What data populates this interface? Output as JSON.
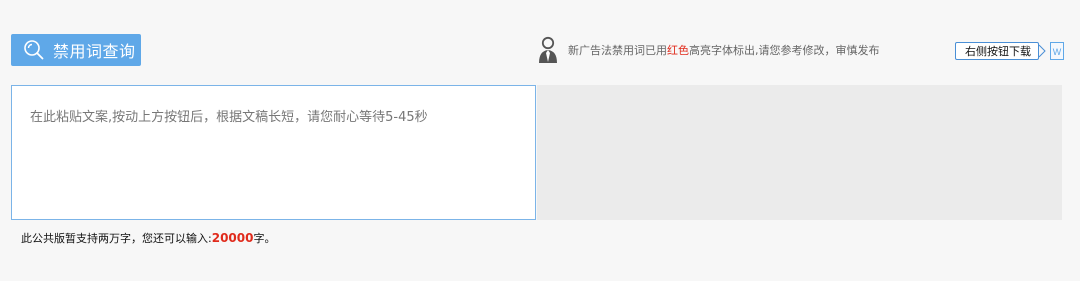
{
  "toolbar": {
    "query_button_label": "禁用词查询",
    "query_icon": "search-icon"
  },
  "notice": {
    "icon": "person-icon",
    "text_before": "新广告法禁用词已用",
    "highlight": "红色",
    "text_after": "高亮字体标出,请您参考修改，审慎发布",
    "highlight_color": "#e02b1c"
  },
  "download": {
    "label": "右侧按钮下载",
    "icon": "word-doc-icon",
    "icon_letter": "W"
  },
  "editor": {
    "placeholder": "在此粘贴文案,按动上方按钮后，根据文稿长短，请您耐心等待5-45秒",
    "value": ""
  },
  "counter": {
    "prefix": "此公共版暂支持两万字，您还可以输入:",
    "remaining": "20000",
    "suffix": "字。"
  },
  "colors": {
    "accent": "#5fa8e8",
    "border": "#7bb4e8",
    "red": "#e02b1c",
    "page_bg": "#f7f7f7",
    "result_bg": "#ebebeb"
  }
}
